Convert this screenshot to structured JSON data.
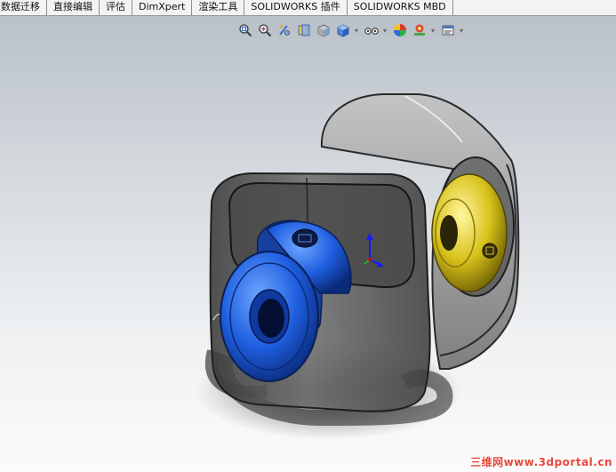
{
  "command_manager": {
    "tabs": [
      {
        "label": "数据迁移"
      },
      {
        "label": "直接编辑"
      },
      {
        "label": "评估"
      },
      {
        "label": "DimXpert"
      },
      {
        "label": "渲染工具"
      },
      {
        "label": "SOLIDWORKS 插件"
      },
      {
        "label": "SOLIDWORKS MBD"
      }
    ]
  },
  "heads_up_toolbar": {
    "buttons": [
      {
        "icon": "zoom-to-fit-icon"
      },
      {
        "icon": "zoom-to-area-icon"
      },
      {
        "icon": "previous-view-icon"
      },
      {
        "icon": "section-view-icon"
      },
      {
        "icon": "view-orientation-icon",
        "has_dropdown": true
      },
      {
        "icon": "display-style-icon",
        "has_dropdown": true
      },
      {
        "icon": "hide-show-items-icon",
        "has_dropdown": true
      },
      {
        "icon": "edit-appearance-icon"
      },
      {
        "icon": "apply-scene-icon",
        "has_dropdown": true
      },
      {
        "icon": "view-settings-icon",
        "has_dropdown": true
      }
    ]
  },
  "viewport": {
    "model": "coupling-assembly",
    "colors": {
      "housing": "#5c5c5c",
      "flange_blue": "#1f5fe0",
      "flange_yellow": "#d8c21a",
      "triad_blue": "#1a1aff",
      "triad_green": "#19b419"
    }
  },
  "watermark": {
    "text": "三维网www.3dportal.cn"
  }
}
